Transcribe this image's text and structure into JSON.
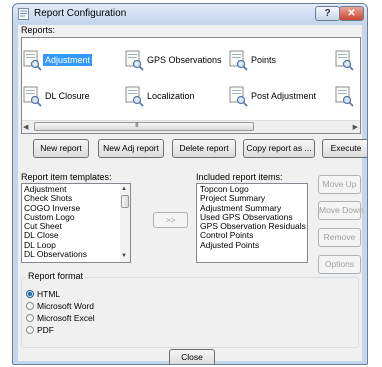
{
  "window": {
    "title": "Report Configuration",
    "help_label": "?",
    "close_label": "✕"
  },
  "reports": {
    "label": "Reports:",
    "items": [
      {
        "label": "Adjustment",
        "selected": true
      },
      {
        "label": "GPS Observations",
        "selected": false
      },
      {
        "label": "Points",
        "selected": false
      },
      {
        "label": "",
        "selected": false
      },
      {
        "label": "DL Closure",
        "selected": false
      },
      {
        "label": "Localization",
        "selected": false
      },
      {
        "label": "Post Adjustment",
        "selected": false
      },
      {
        "label": "",
        "selected": false
      }
    ],
    "scroll": {
      "left_arrow": "◀",
      "right_arrow": "▶",
      "grip": "III"
    }
  },
  "actions": {
    "new_report": "New report",
    "new_adj_report": "New Adj report",
    "delete_report": "Delete report",
    "copy_report": "Copy report as ...",
    "execute": "Execute"
  },
  "templates": {
    "label": "Report item templates:",
    "items": [
      "Adjustment",
      "Check Shots",
      "COGO Inverse",
      "Custom Logo",
      "Cut Sheet",
      "DL Close",
      "DL Loop",
      "DL Observations"
    ],
    "scroll": {
      "up": "▲",
      "down": "▼"
    }
  },
  "move_button": ">>",
  "included": {
    "label": "Included report items:",
    "items": [
      "Topcon Logo",
      "Project Summary",
      "Adjustment Summary",
      "Used GPS Observations",
      "GPS Observation Residuals",
      "Control Points",
      "Adjusted Points"
    ]
  },
  "side_buttons": {
    "move_up": "Move Up",
    "move_down": "Move Down",
    "remove": "Remove",
    "options": "Options"
  },
  "format": {
    "label": "Report format",
    "options": [
      {
        "label": "HTML",
        "selected": true
      },
      {
        "label": "Microsoft Word",
        "selected": false
      },
      {
        "label": "Microsoft Excel",
        "selected": false
      },
      {
        "label": "PDF",
        "selected": false
      }
    ]
  },
  "close_button": "Close",
  "colors": {
    "selection": "#3399ff",
    "title_bar": "#c4d6ec",
    "close_red": "#c9452e"
  }
}
